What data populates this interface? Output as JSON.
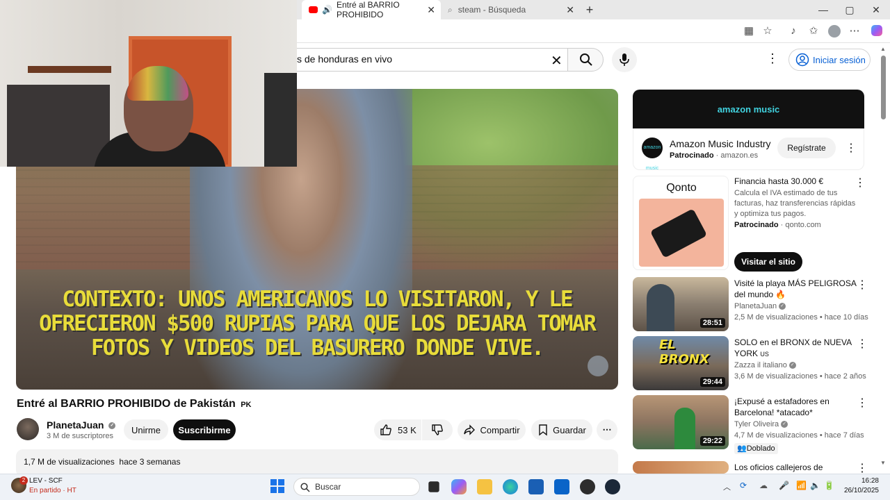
{
  "browser": {
    "tabs": [
      {
        "title": "Entré al BARRIO PROHIBIDO",
        "active": true
      },
      {
        "title": "steam - Búsqueda",
        "active": false
      }
    ],
    "new_tab_symbol": "+",
    "window_controls": [
      "—",
      "▢",
      "✕"
    ]
  },
  "youtube": {
    "search_query": "s de honduras en vivo",
    "sign_in_label": "Iniciar sesión",
    "video": {
      "subtitle_lines": [
        "CONTEXTO: UNOS AMERICANOS LO VISITARON, Y LE",
        "OFRECIERON $500 RUPIAS PARA QUE LOS DEJARA TOMAR",
        "FOTOS Y VIDEOS DEL BASURERO DONDE VIVE."
      ],
      "title": "Entré al BARRIO PROHIBIDO de Pakistán",
      "title_suffix": "PK",
      "channel_name": "PlanetaJuan",
      "subscribers": "3 M de suscriptores",
      "join_label": "Unirme",
      "subscribe_label": "Suscribirme",
      "likes": "53 K",
      "share_label": "Compartir",
      "save_label": "Guardar",
      "views_line": "1,7 M de visualizaciones  hace 3 semanas"
    },
    "sidebar": {
      "amazon_ad": {
        "banner_text": "amazon music",
        "logo_text": "amazon music",
        "title": "Amazon Music Industry",
        "sponsored": "Patrocinado",
        "domain": "amazon.es",
        "cta": "Regístrate"
      },
      "qonto_ad": {
        "logo": "Qonto",
        "title": "Financia hasta 30.000 €",
        "description": "Calcula el IVA estimado de tus facturas, haz transferencias rápidas y optimiza tus pagos.",
        "sponsored": "Patrocinado",
        "domain": "qonto.com",
        "cta": "Visitar el sitio"
      },
      "videos": [
        {
          "title": "Visité la playa MÁS PELIGROSA del mundo 🔥",
          "channel": "PlanetaJuan",
          "meta": "2,5 M de visualizaciones • hace 10 días",
          "duration": "28:51"
        },
        {
          "title": "SOLO en el BRONX de NUEVA YORK",
          "title_suffix": "US",
          "channel": "Zazza il italiano",
          "meta": "3,6 M de visualizaciones • hace 2 años",
          "duration": "29:44",
          "thumb_text": "EL BRONX"
        },
        {
          "title": "¡Expusé a estafadores en Barcelona! *atacado*",
          "channel": "Tyler Oliveira",
          "meta": "4,7 M de visualizaciones • hace 7 días",
          "duration": "29:22",
          "badge": "Doblado"
        },
        {
          "title": "Los oficios callejeros de"
        }
      ]
    }
  },
  "taskbar": {
    "weather_badge": "2",
    "weather_title": "LEV - SCF",
    "weather_sub": "En partido · HT",
    "search_placeholder": "Buscar",
    "time": "16:28",
    "date": "26/10/2025"
  }
}
